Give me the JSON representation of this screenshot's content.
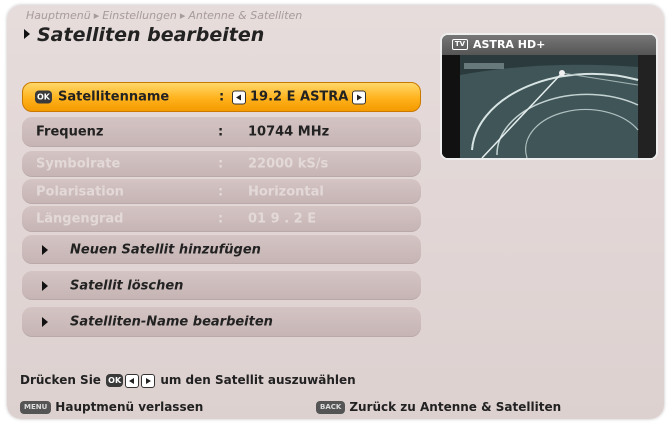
{
  "breadcrumb": [
    "Hauptmenü",
    "Einstellungen",
    "Antenne & Satelliten"
  ],
  "title": "Satelliten bearbeiten",
  "rows": [
    {
      "label": "Satellitenname",
      "colon": ":",
      "value": "19.2 E ASTRA",
      "state": "selected"
    },
    {
      "label": "Frequenz",
      "colon": ":",
      "value": "10744 MHz",
      "state": "normal"
    },
    {
      "label": "Symbolrate",
      "colon": ":",
      "value": "22000 kS/s",
      "state": "disabled"
    },
    {
      "label": "Polarisation",
      "colon": ":",
      "value": "Horizontal",
      "state": "disabled"
    },
    {
      "label": "Längengrad",
      "colon": ":",
      "value": "01 9 . 2 E",
      "state": "disabled"
    }
  ],
  "actions": [
    {
      "label": "Neuen Satellit hinzufügen"
    },
    {
      "label": "Satellit löschen"
    },
    {
      "label": "Satelliten-Name bearbeiten"
    }
  ],
  "preview": {
    "badge": "TV",
    "channel": "ASTRA HD+"
  },
  "hint": {
    "prefix": "Drücken Sie",
    "ok_key": "OK",
    "suffix": "um den Satellit auszuwählen"
  },
  "footer": {
    "left_key": "MENU",
    "left_label": "Hauptmenü verlassen",
    "right_key": "BACK",
    "right_label": "Zurück zu Antenne & Satelliten"
  },
  "colors": {
    "selected_row": "#ffb21c",
    "row": "#c8b8b7",
    "background": "#e3d8d7"
  }
}
